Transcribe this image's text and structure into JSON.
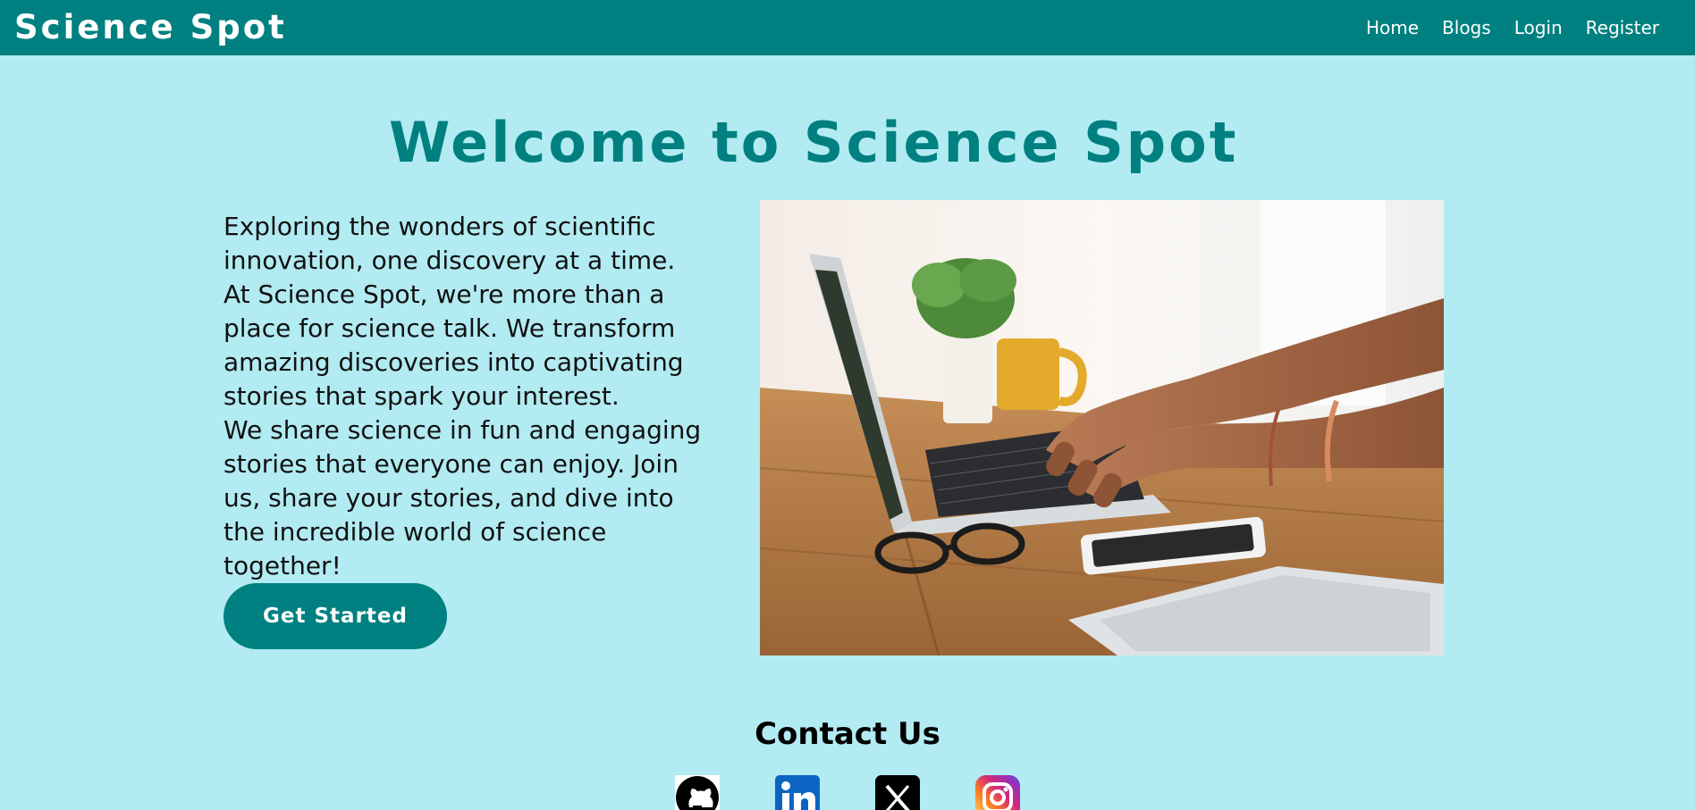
{
  "header": {
    "brand": "Science Spot",
    "nav": {
      "home": "Home",
      "blogs": "Blogs",
      "login": "Login",
      "register": "Register"
    }
  },
  "hero": {
    "title": "Welcome to Science Spot",
    "paragraphs": [
      "Exploring the wonders of scientific innovation, one discovery at a time.",
      "At Science Spot, we're more than a place for science talk. We transform amazing discoveries into captivating stories that spark your interest.",
      "We share science in fun and engaging stories that everyone can enjoy. Join us, share your stories, and dive into the incredible world of science together!"
    ],
    "cta_label": "Get Started",
    "image_alt": "Hands typing on a laptop on a wooden desk"
  },
  "contact": {
    "title": "Contact Us",
    "icons": [
      "github-icon",
      "linkedin-icon",
      "x-icon",
      "instagram-icon"
    ]
  },
  "colors": {
    "header_bg": "#008080",
    "page_bg": "#b2ebf2",
    "accent": "#008080"
  }
}
